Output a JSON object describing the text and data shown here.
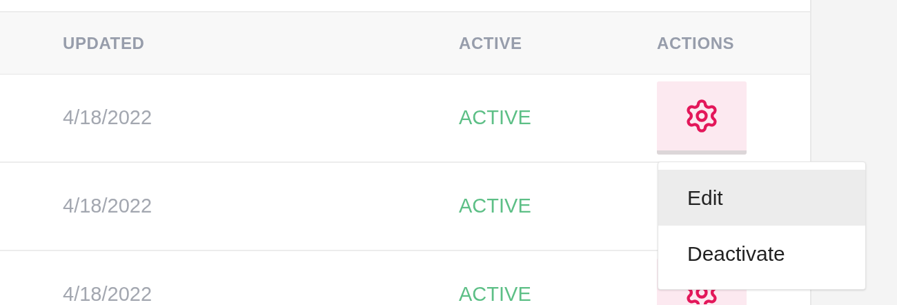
{
  "table": {
    "columns": [
      {
        "label": "UPDATED"
      },
      {
        "label": "ACTIVE"
      },
      {
        "label": "ACTIONS"
      }
    ],
    "rows": [
      {
        "updated": "4/18/2022",
        "status": "ACTIVE"
      },
      {
        "updated": "4/18/2022",
        "status": "ACTIVE"
      },
      {
        "updated": "4/18/2022",
        "status": "ACTIVE"
      }
    ]
  },
  "menu": {
    "items": [
      {
        "label": "Edit",
        "selected": true
      },
      {
        "label": "Deactivate",
        "selected": false
      }
    ]
  }
}
